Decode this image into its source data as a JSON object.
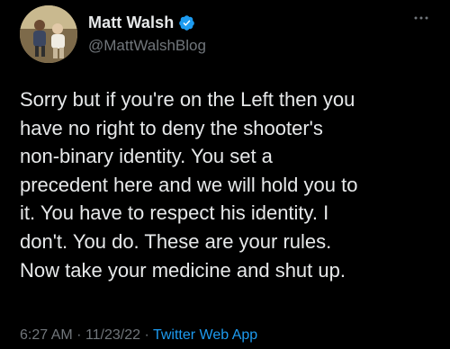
{
  "author": {
    "display_name": "Matt Walsh",
    "handle": "@MattWalshBlog",
    "verified": true,
    "avatar_icon": "profile-photo-avatar"
  },
  "tweet": {
    "text": "Sorry but if you're on the Left then you\nhave no right to deny the shooter's\nnon-binary identity. You set a\nprecedent here and we will hold you to\nit. You have to respect his identity. I\ndon't. You do. These are your rules.\nNow take your medicine and shut up.",
    "time": "6:27 AM",
    "sep1": "·",
    "date": "11/23/22",
    "sep2": "·",
    "source": "Twitter Web App"
  },
  "icons": {
    "verified": "verified-badge-icon",
    "more": "more-options-icon"
  },
  "colors": {
    "background": "#000000",
    "text": "#e7e9ea",
    "secondary_text": "#71767b",
    "accent": "#1d9bf0"
  }
}
